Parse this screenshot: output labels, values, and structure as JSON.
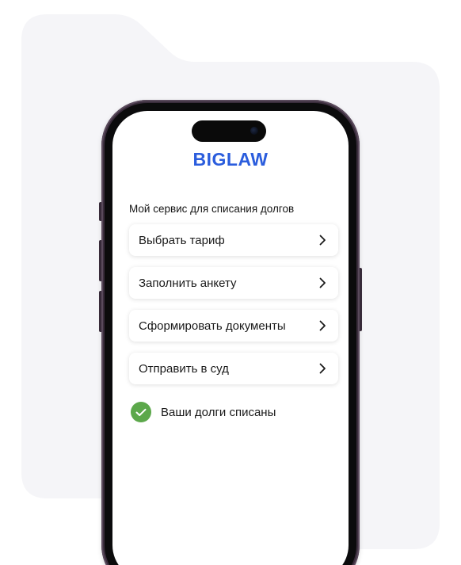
{
  "app": {
    "brand": "BIGLAW",
    "brand_color": "#2b5ddd"
  },
  "main": {
    "subtitle": "Мой сервис для списания долгов",
    "steps": [
      {
        "label": "Выбрать тариф",
        "icon": "chevron-right-icon"
      },
      {
        "label": "Заполнить анкету",
        "icon": "chevron-right-icon"
      },
      {
        "label": "Сформировать документы",
        "icon": "chevron-right-icon"
      },
      {
        "label": "Отправить в суд",
        "icon": "chevron-right-icon"
      }
    ],
    "result": {
      "label": "Ваши долги списаны",
      "icon": "check-circle-icon",
      "icon_color": "#5ca84b"
    }
  }
}
